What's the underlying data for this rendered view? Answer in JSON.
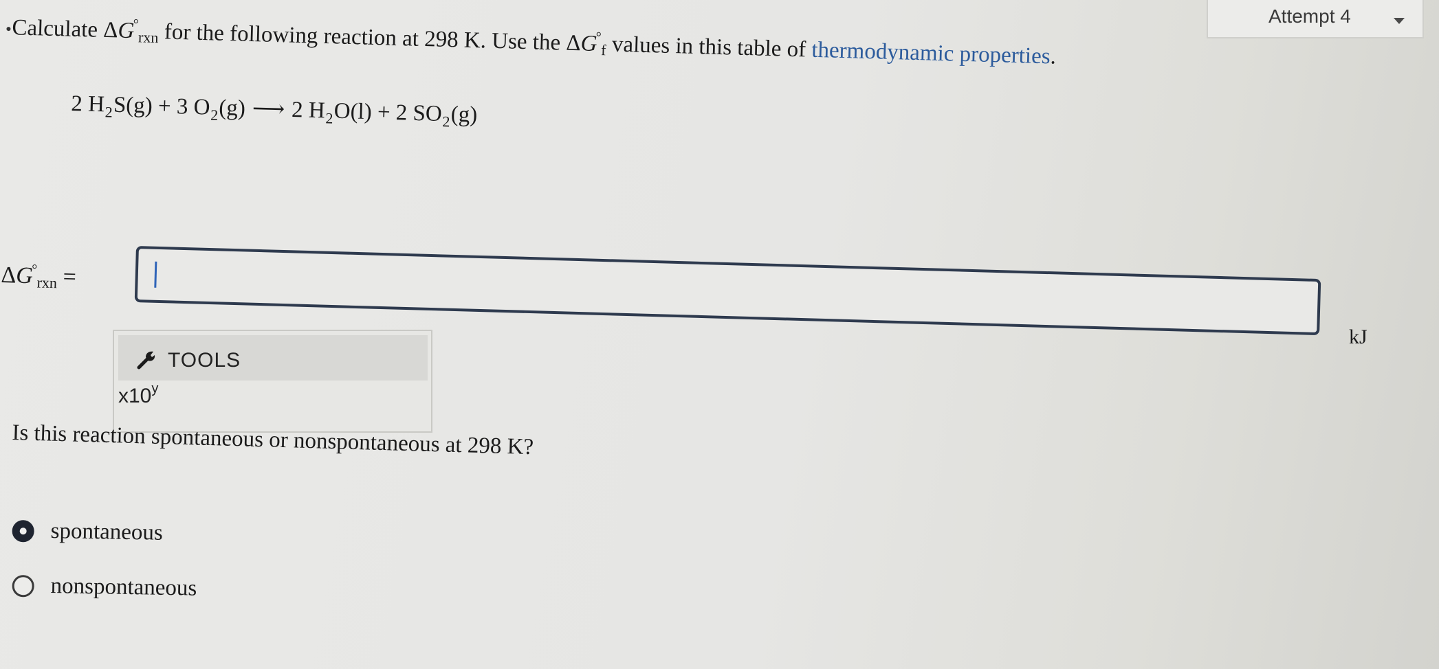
{
  "attempt": {
    "label": "Attempt 4"
  },
  "question": {
    "prefix": "Calculate ",
    "delta": "Δ",
    "g": "G",
    "deg": "°",
    "rxn": "rxn",
    "mid": " for the following reaction at 298 K. Use the ",
    "f": "f",
    "suffix": " values in this table of ",
    "link_text": "thermodynamic properties",
    "end": "."
  },
  "equation": {
    "c1": "2 H",
    "s1": "2",
    "p1": "S(g) + 3 O",
    "s2": "2",
    "p2": "(g)",
    "arrow": "⟶",
    "c2": "2 H",
    "s3": "2",
    "p3": "O(l) + 2 SO",
    "s4": "2",
    "p4": "(g)"
  },
  "answer": {
    "label_delta": "Δ",
    "label_g": "G",
    "label_deg": "°",
    "label_rxn": "rxn",
    "label_eq": " =",
    "value": "",
    "unit": "kJ"
  },
  "tools": {
    "label": "TOOLS",
    "sci_base": "x10",
    "sci_exp": "y"
  },
  "question2": {
    "text": "Is this reaction spontaneous or nonspontaneous at 298 K?"
  },
  "options": [
    {
      "label": "spontaneous",
      "selected": true
    },
    {
      "label": "nonspontaneous",
      "selected": false
    }
  ]
}
